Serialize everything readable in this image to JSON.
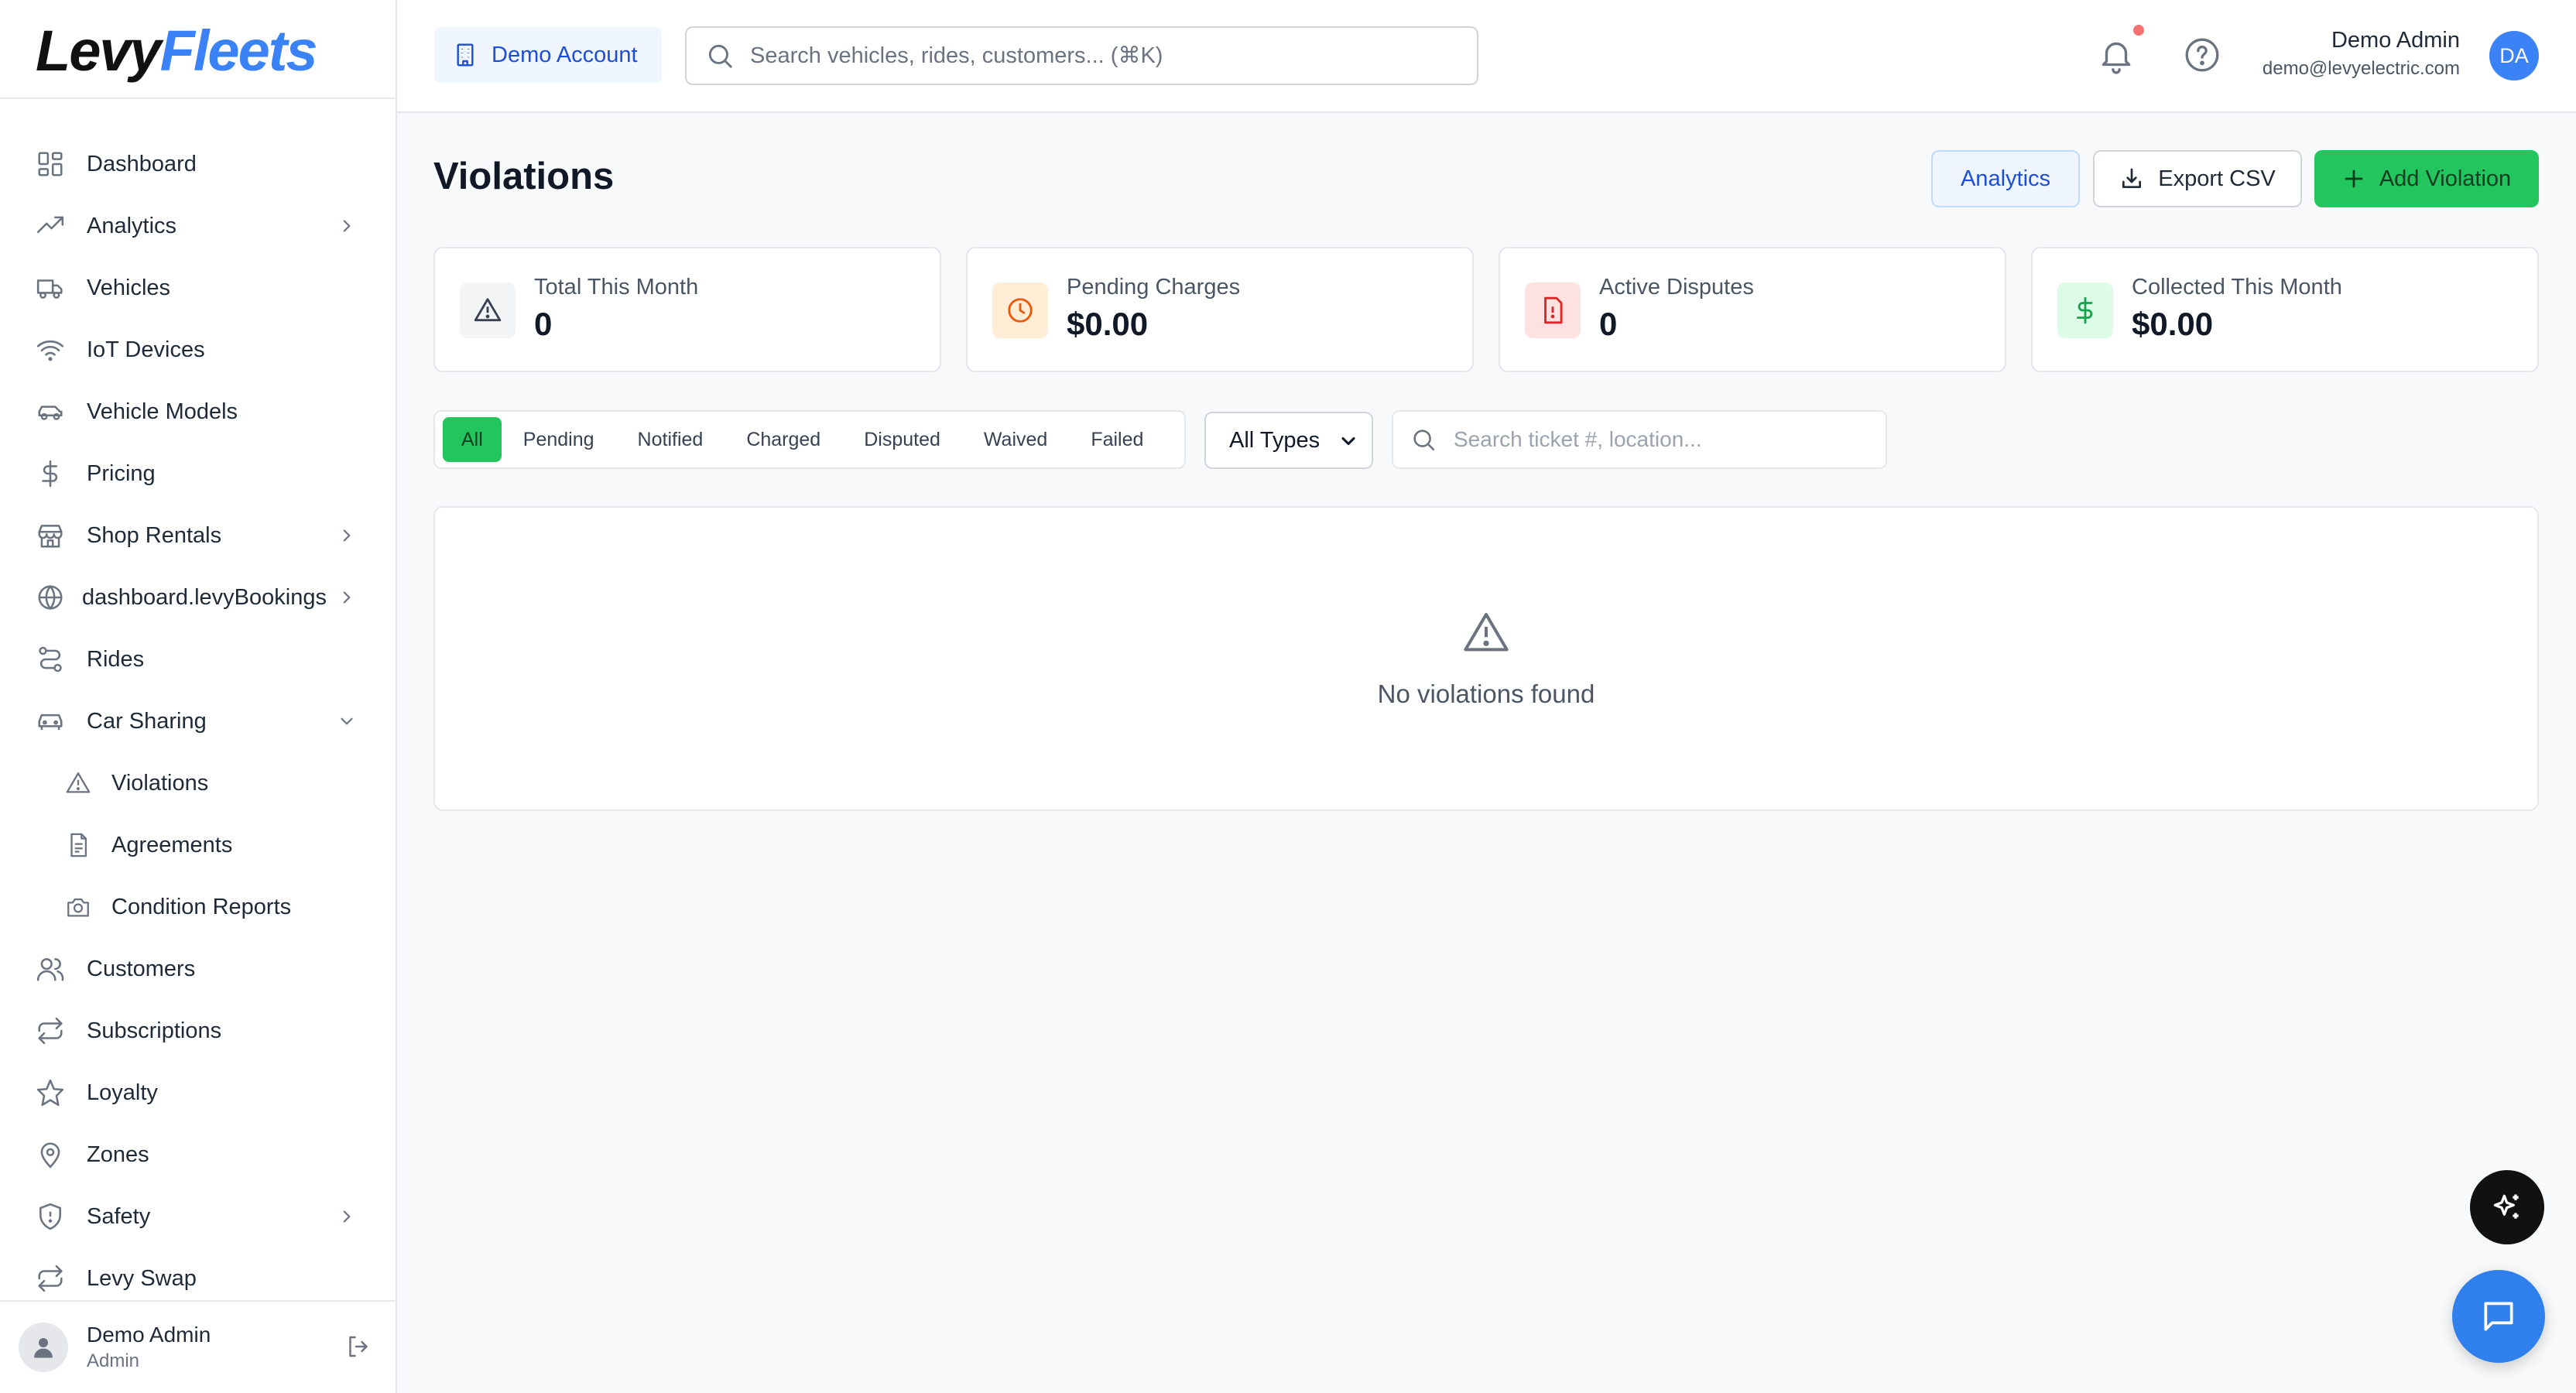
{
  "brand": {
    "part1": "Levy",
    "part2": "Fleets"
  },
  "sidebar": {
    "items": [
      {
        "label": "Dashboard",
        "icon": "dashboard-icon"
      },
      {
        "label": "Analytics",
        "icon": "trend-icon",
        "chevron": "right"
      },
      {
        "label": "Vehicles",
        "icon": "truck-icon"
      },
      {
        "label": "IoT Devices",
        "icon": "wifi-icon"
      },
      {
        "label": "Vehicle Models",
        "icon": "car-icon"
      },
      {
        "label": "Pricing",
        "icon": "dollar-icon"
      },
      {
        "label": "Shop Rentals",
        "icon": "store-icon",
        "chevron": "right"
      },
      {
        "label": "dashboard.levyBookings",
        "icon": "globe-icon",
        "chevron": "right"
      },
      {
        "label": "Rides",
        "icon": "route-icon"
      },
      {
        "label": "Car Sharing",
        "icon": "car-icon",
        "chevron": "down",
        "expanded": true
      },
      {
        "label": "Violations",
        "icon": "warning-icon",
        "sub": true,
        "active": true
      },
      {
        "label": "Agreements",
        "icon": "document-icon",
        "sub": true
      },
      {
        "label": "Condition Reports",
        "icon": "camera-icon",
        "sub": true
      },
      {
        "label": "Customers",
        "icon": "users-icon"
      },
      {
        "label": "Subscriptions",
        "icon": "repeat-icon"
      },
      {
        "label": "Loyalty",
        "icon": "star-icon"
      },
      {
        "label": "Zones",
        "icon": "map-pin-icon"
      },
      {
        "label": "Safety",
        "icon": "shield-icon",
        "chevron": "right"
      },
      {
        "label": "Levy Swap",
        "icon": "repeat-icon"
      }
    ],
    "user": {
      "name": "Demo Admin",
      "role": "Admin"
    }
  },
  "topbar": {
    "account_label": "Demo Account",
    "search_placeholder": "Search vehicles, rides, customers... (⌘K)",
    "user_name": "Demo Admin",
    "user_email": "demo@levyelectric.com",
    "avatar_initials": "DA"
  },
  "page": {
    "title": "Violations",
    "buttons": {
      "analytics": "Analytics",
      "export": "Export CSV",
      "add": "Add Violation"
    },
    "stats": [
      {
        "label": "Total This Month",
        "value": "0",
        "icon": "warning-icon",
        "bg": "#f3f4f6",
        "fg": "#374151"
      },
      {
        "label": "Pending Charges",
        "value": "$0.00",
        "icon": "clock-icon",
        "bg": "#ffedd5",
        "fg": "#ea580c"
      },
      {
        "label": "Active Disputes",
        "value": "0",
        "icon": "file-alert-icon",
        "bg": "#fee2e2",
        "fg": "#dc2626"
      },
      {
        "label": "Collected This Month",
        "value": "$0.00",
        "icon": "dollar-icon",
        "bg": "#dcfce7",
        "fg": "#16a34a"
      }
    ],
    "filter_tabs": [
      "All",
      "Pending",
      "Notified",
      "Charged",
      "Disputed",
      "Waived",
      "Failed"
    ],
    "active_tab": "All",
    "type_filter": {
      "selected": "All Types",
      "options": [
        "All Types"
      ]
    },
    "ticket_search_placeholder": "Search ticket #, location...",
    "empty_message": "No violations found"
  },
  "colors": {
    "accent_green": "#22c55e",
    "accent_blue": "#3b82f6",
    "notification_dot": "#f87171"
  }
}
